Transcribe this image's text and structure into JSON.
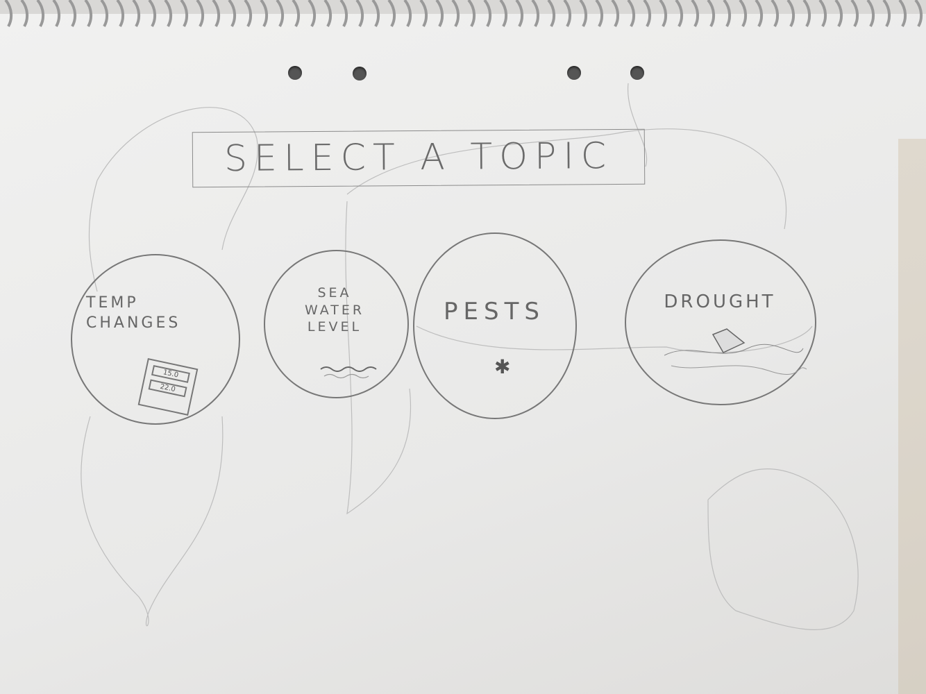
{
  "header": {
    "title": "SELECT A TOPIC"
  },
  "topics": [
    {
      "label": "TEMP\nCHANGES",
      "icon": "thermometer-readout-icon",
      "readings": [
        "15.0",
        "22.0"
      ]
    },
    {
      "label": "SEA\nWATER\nLEVEL",
      "icon": "waves-icon"
    },
    {
      "label": "PESTS",
      "icon": "mosquito-icon"
    },
    {
      "label": "DROUGHT",
      "icon": "dry-land-icon"
    }
  ]
}
